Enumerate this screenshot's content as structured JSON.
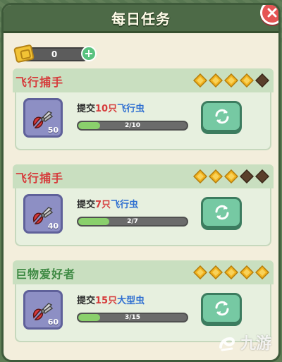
{
  "title": "每日任务",
  "currency": {
    "value": "0",
    "plus": "+"
  },
  "tasks": [
    {
      "title": "飞行捕手",
      "title_color": "red",
      "stars_filled": 4,
      "stars_total": 5,
      "item_count": "50",
      "desc_prefix": "提交",
      "desc_amount": "10只",
      "desc_target": "飞行虫",
      "progress_text": "2/10",
      "progress_fraction": 0.2
    },
    {
      "title": "飞行捕手",
      "title_color": "red",
      "stars_filled": 3,
      "stars_total": 5,
      "item_count": "40",
      "desc_prefix": "提交",
      "desc_amount": "7只",
      "desc_target": "飞行虫",
      "progress_text": "2/7",
      "progress_fraction": 0.2857
    },
    {
      "title": "巨物爱好者",
      "title_color": "green",
      "stars_filled": 5,
      "stars_total": 5,
      "item_count": "60",
      "desc_prefix": "提交",
      "desc_amount": "15只",
      "desc_target": "大型虫",
      "progress_text": "3/15",
      "progress_fraction": 0.2
    }
  ],
  "watermark": "九游",
  "colors": {
    "accent_red": "#d63b3b",
    "accent_blue": "#2f6fd1",
    "accent_green": "#3f8a44",
    "star_filled": "#f2b31f",
    "star_empty": "#5a3f2a",
    "progress_fill": "#8ad06c"
  },
  "icons": {
    "close": "close-icon",
    "ticket": "ticket-icon",
    "item": "pliers-icon",
    "refresh": "refresh-icon",
    "star": "diamond-star-icon"
  }
}
